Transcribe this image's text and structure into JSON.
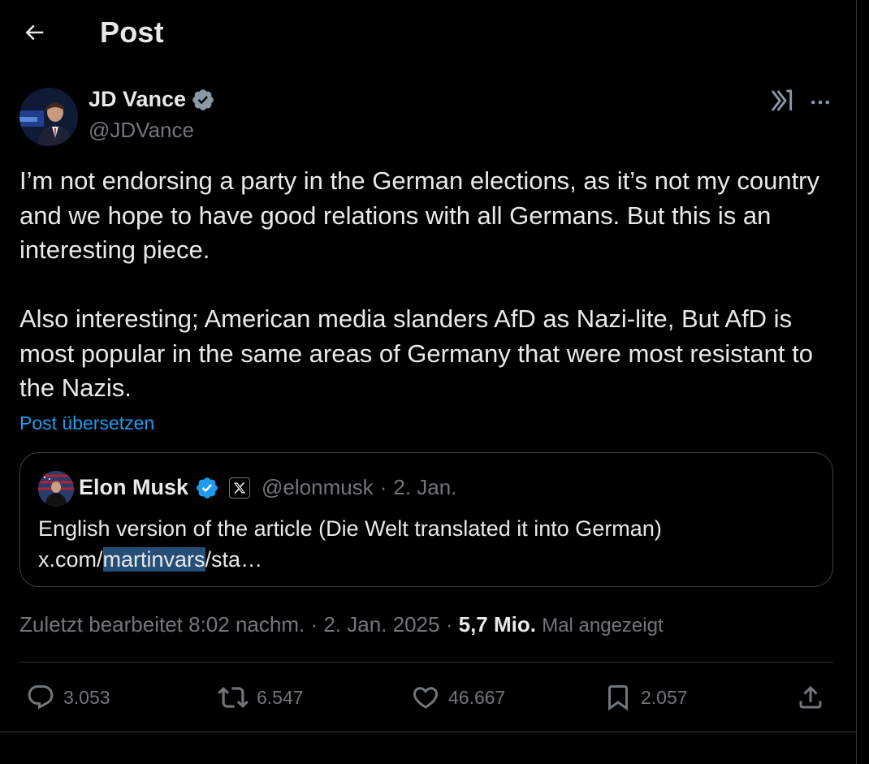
{
  "header": {
    "title": "Post"
  },
  "author": {
    "name": "JD Vance",
    "handle": "@JDVance"
  },
  "tweet": {
    "paragraphs": [
      "I’m not endorsing a party in the German elections, as it’s not my country and we hope to have good relations with all Germans. But this is an interesting piece.",
      "Also interesting; American media slanders AfD as Nazi-lite, But AfD is most popular in the same areas of Germany that were most resistant to the Nazis."
    ],
    "translate_label": "Post übersetzen"
  },
  "quote": {
    "name": "Elon Musk",
    "handle": "@elonmusk",
    "separator": "·",
    "date": "2. Jan.",
    "text": "English version of the article (Die Welt translated it into German)",
    "link_prefix": "x.com/",
    "link_highlight": "martinvars",
    "link_suffix": "/sta…"
  },
  "meta": {
    "edited": "Zuletzt bearbeitet 8:02 nachm.",
    "sep1": "·",
    "date": "2. Jan. 2025",
    "sep2": "·",
    "views": "5,7 Mio.",
    "views_label": "Mal angezeigt"
  },
  "actions": {
    "replies": "3.053",
    "reposts": "6.547",
    "likes": "46.667",
    "bookmarks": "2.057"
  },
  "colors": {
    "background": "#000000",
    "text": "#e7e9ea",
    "secondary": "#71767b",
    "accent": "#1d9bf0",
    "border": "#2f3336",
    "verified": "#1d9bf0"
  },
  "icons": {
    "back": "arrow-left-icon",
    "verified": "verified-badge-icon",
    "grok": "grok-icon",
    "more": "more-dots-icon",
    "reply": "reply-icon",
    "repost": "repost-icon",
    "like": "heart-icon",
    "bookmark": "bookmark-icon",
    "share": "share-icon"
  }
}
